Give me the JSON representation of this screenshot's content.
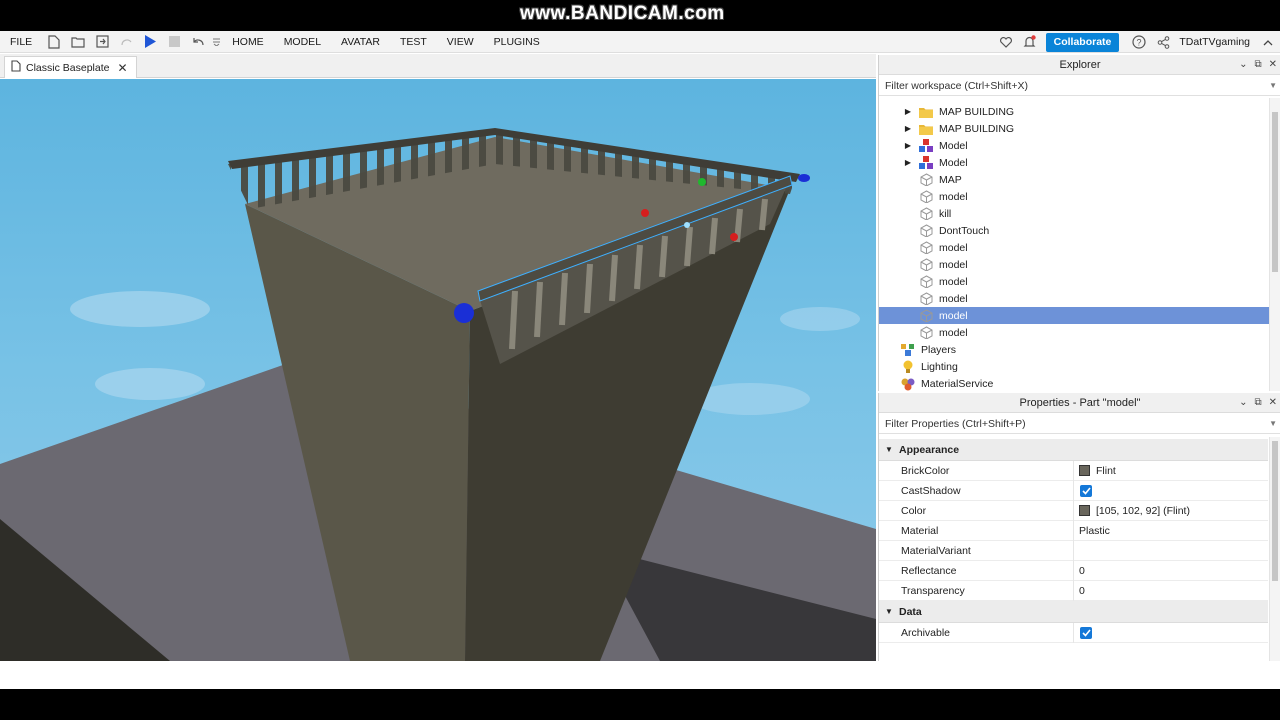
{
  "watermark": "www.BANDICAM.com",
  "menu": {
    "file": "FILE",
    "tabs": [
      "HOME",
      "MODEL",
      "AVATAR",
      "TEST",
      "VIEW",
      "PLUGINS"
    ]
  },
  "header": {
    "collaborate_label": "Collaborate",
    "username": "TDatTVgaming"
  },
  "doc_tab": {
    "label": "Classic Baseplate"
  },
  "explorer": {
    "title": "Explorer",
    "filter_placeholder": "Filter workspace (Ctrl+Shift+X)",
    "items": [
      {
        "label": "MAP BUILDING",
        "icon": "folder-icon",
        "expandable": true,
        "selected": false
      },
      {
        "label": "MAP BUILDING",
        "icon": "folder-icon",
        "expandable": true,
        "selected": false
      },
      {
        "label": "Model",
        "icon": "model-icon",
        "expandable": true,
        "selected": false
      },
      {
        "label": "Model",
        "icon": "model-icon",
        "expandable": true,
        "selected": false
      },
      {
        "label": "MAP",
        "icon": "part-icon",
        "expandable": false,
        "selected": false
      },
      {
        "label": "model",
        "icon": "part-icon",
        "expandable": false,
        "selected": false
      },
      {
        "label": "kill",
        "icon": "part-icon",
        "expandable": false,
        "selected": false
      },
      {
        "label": "DontTouch",
        "icon": "part-icon",
        "expandable": false,
        "selected": false
      },
      {
        "label": "model",
        "icon": "part-icon",
        "expandable": false,
        "selected": false
      },
      {
        "label": "model",
        "icon": "part-icon",
        "expandable": false,
        "selected": false
      },
      {
        "label": "model",
        "icon": "part-icon",
        "expandable": false,
        "selected": false
      },
      {
        "label": "model",
        "icon": "part-icon",
        "expandable": false,
        "selected": false
      },
      {
        "label": "model",
        "icon": "part-icon",
        "expandable": false,
        "selected": true
      },
      {
        "label": "model",
        "icon": "part-icon",
        "expandable": false,
        "selected": false
      },
      {
        "label": "Players",
        "icon": "players-icon",
        "expandable": false,
        "selected": false
      },
      {
        "label": "Lighting",
        "icon": "lighting-icon",
        "expandable": false,
        "selected": false
      },
      {
        "label": "MaterialService",
        "icon": "material-service-icon",
        "expandable": false,
        "selected": false
      }
    ]
  },
  "properties": {
    "title": "Properties - Part \"model\"",
    "filter_placeholder": "Filter Properties (Ctrl+Shift+P)",
    "categories": [
      {
        "name": "Appearance",
        "rows": [
          {
            "name": "BrickColor",
            "value": "Flint",
            "type": "swatch",
            "color": "#69665c"
          },
          {
            "name": "CastShadow",
            "value": "",
            "type": "checkbox",
            "checked": true
          },
          {
            "name": "Color",
            "value": "[105, 102, 92] (Flint)",
            "type": "swatch",
            "color": "#69665c"
          },
          {
            "name": "Material",
            "value": "Plastic",
            "type": "text"
          },
          {
            "name": "MaterialVariant",
            "value": "",
            "type": "text"
          },
          {
            "name": "Reflectance",
            "value": "0",
            "type": "text"
          },
          {
            "name": "Transparency",
            "value": "0",
            "type": "text"
          }
        ]
      },
      {
        "name": "Data",
        "rows": [
          {
            "name": "Archivable",
            "value": "",
            "type": "checkbox",
            "checked": true
          }
        ]
      }
    ]
  },
  "colors": {
    "accent": "#0a84d8",
    "selection": "#6d92d8",
    "sky": "#5cb6e0",
    "tower": "#4f4c40"
  }
}
